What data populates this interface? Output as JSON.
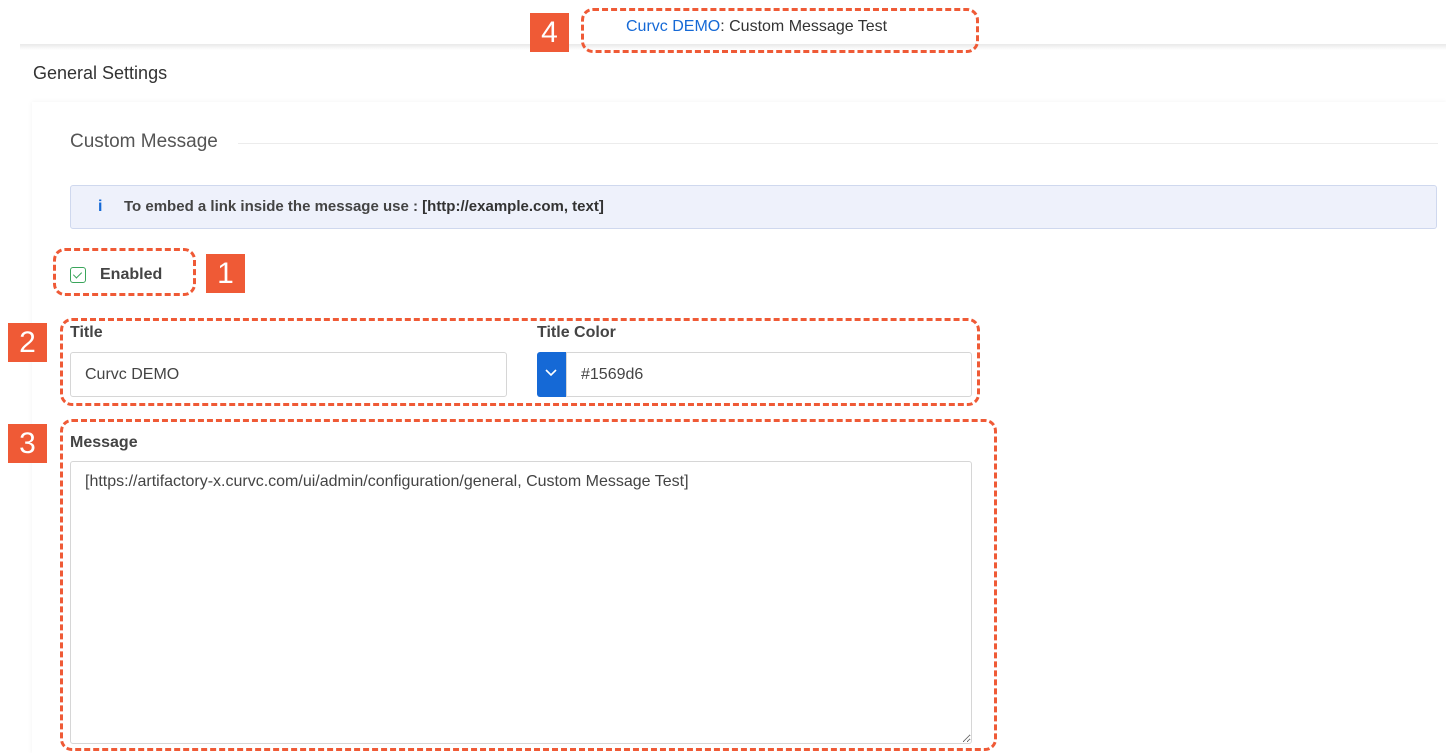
{
  "banner": {
    "title": "Curvc DEMO",
    "separator": ": ",
    "message": "Custom Message Test",
    "title_color": "#1569d6"
  },
  "page": {
    "title": "General Settings"
  },
  "custom_message": {
    "section_title": "Custom Message",
    "info_icon": "info-icon",
    "info_text": "To embed a link inside the message use : ",
    "info_code": "[http://example.com, text]",
    "enabled_label": "Enabled",
    "enabled_checked": true,
    "title_label": "Title",
    "title_value": "Curvc DEMO",
    "title_color_label": "Title Color",
    "title_color_value": "#1569d6",
    "message_label": "Message",
    "message_value": "[https://artifactory-x.curvc.com/ui/admin/configuration/general, Custom Message Test]"
  },
  "annotations": {
    "badge_1": "1",
    "badge_2": "2",
    "badge_3": "3",
    "badge_4": "4",
    "color": "#ef5a36"
  }
}
